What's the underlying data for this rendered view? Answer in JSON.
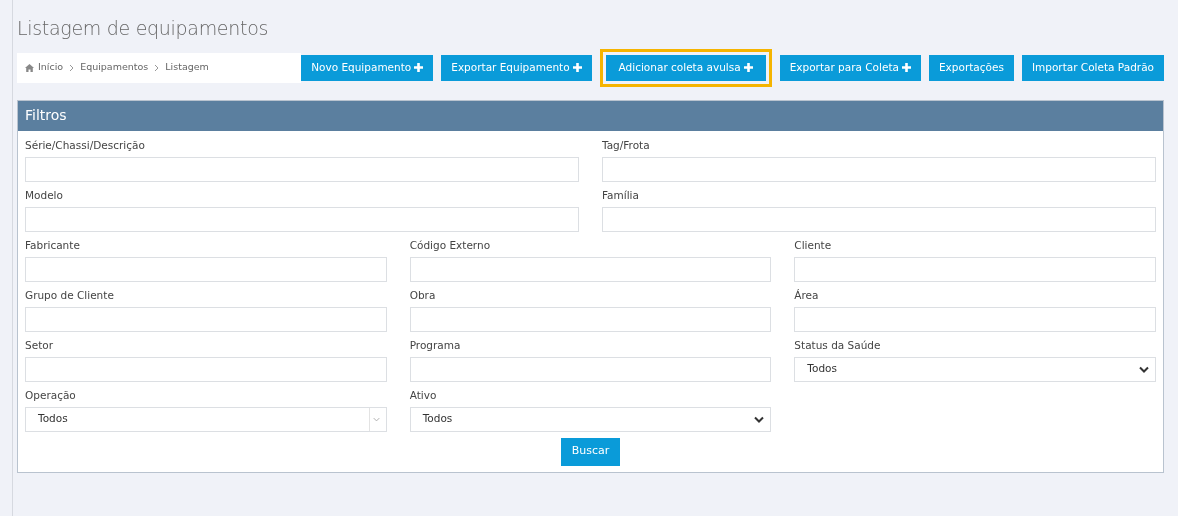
{
  "title": "Listagem de equipamentos",
  "breadcrumb": [
    "Início",
    "Equipamentos",
    "Listagem"
  ],
  "buttons": [
    {
      "label": "Novo Equipamento",
      "plus": true,
      "highlighted": false
    },
    {
      "label": "Exportar Equipamento",
      "plus": true,
      "highlighted": false
    },
    {
      "label": "Adicionar coleta avulsa",
      "plus": true,
      "highlighted": true
    },
    {
      "label": "Exportar para Coleta",
      "plus": true,
      "highlighted": false
    },
    {
      "label": "Exportações",
      "plus": false,
      "highlighted": false
    },
    {
      "label": "Importar Coleta Padrão",
      "plus": false,
      "highlighted": false
    }
  ],
  "filters": {
    "title": "Filtros",
    "rows": [
      [
        {
          "label": "Série/Chassi/Descrição",
          "kind": "text"
        },
        {
          "label": "Tag/Frota",
          "kind": "text"
        }
      ],
      [
        {
          "label": "Modelo",
          "kind": "text"
        },
        {
          "label": "Família",
          "kind": "text"
        }
      ],
      [
        {
          "label": "Fabricante",
          "kind": "text"
        },
        {
          "label": "Código Externo",
          "kind": "text"
        },
        {
          "label": "Cliente",
          "kind": "text"
        }
      ],
      [
        {
          "label": "Grupo de Cliente",
          "kind": "text"
        },
        {
          "label": "Obra",
          "kind": "text"
        },
        {
          "label": "Área",
          "kind": "text"
        }
      ],
      [
        {
          "label": "Setor",
          "kind": "text"
        },
        {
          "label": "Programa",
          "kind": "text"
        },
        {
          "label": "Status da Saúde",
          "kind": "select",
          "value": "Todos"
        }
      ],
      [
        {
          "label": "Operação",
          "kind": "multiselect",
          "value": "Todos"
        },
        {
          "label": "Ativo",
          "kind": "select",
          "value": "Todos"
        }
      ]
    ],
    "search_button": "Buscar"
  }
}
